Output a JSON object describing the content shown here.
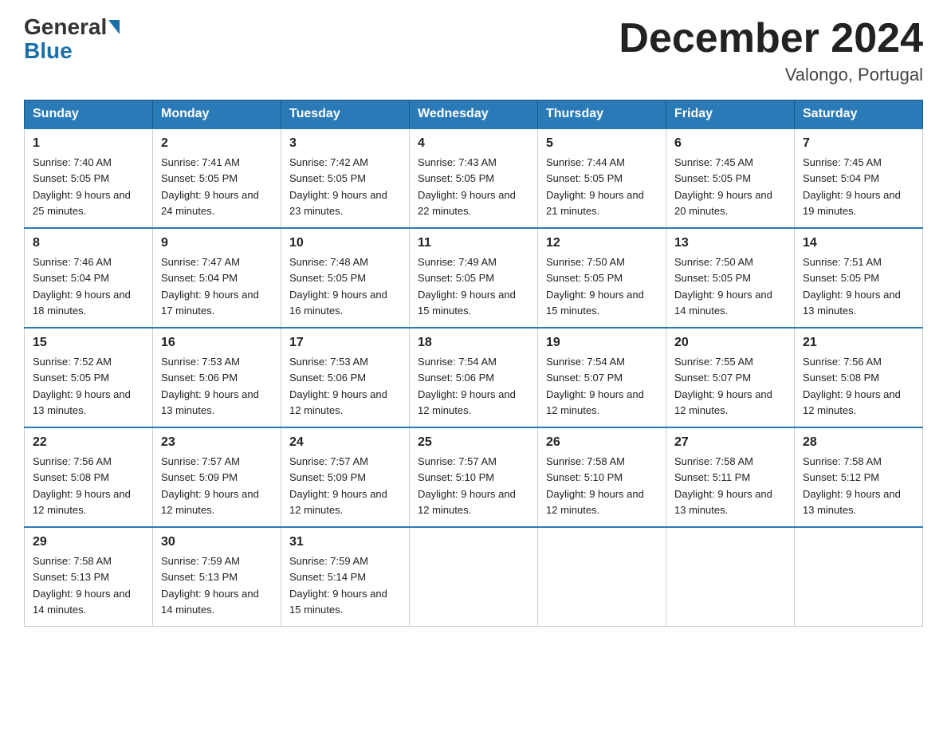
{
  "header": {
    "logo_general": "General",
    "logo_blue": "Blue",
    "month_title": "December 2024",
    "location": "Valongo, Portugal"
  },
  "days_of_week": [
    "Sunday",
    "Monday",
    "Tuesday",
    "Wednesday",
    "Thursday",
    "Friday",
    "Saturday"
  ],
  "weeks": [
    [
      {
        "day": "1",
        "sunrise": "7:40 AM",
        "sunset": "5:05 PM",
        "daylight": "9 hours and 25 minutes."
      },
      {
        "day": "2",
        "sunrise": "7:41 AM",
        "sunset": "5:05 PM",
        "daylight": "9 hours and 24 minutes."
      },
      {
        "day": "3",
        "sunrise": "7:42 AM",
        "sunset": "5:05 PM",
        "daylight": "9 hours and 23 minutes."
      },
      {
        "day": "4",
        "sunrise": "7:43 AM",
        "sunset": "5:05 PM",
        "daylight": "9 hours and 22 minutes."
      },
      {
        "day": "5",
        "sunrise": "7:44 AM",
        "sunset": "5:05 PM",
        "daylight": "9 hours and 21 minutes."
      },
      {
        "day": "6",
        "sunrise": "7:45 AM",
        "sunset": "5:05 PM",
        "daylight": "9 hours and 20 minutes."
      },
      {
        "day": "7",
        "sunrise": "7:45 AM",
        "sunset": "5:04 PM",
        "daylight": "9 hours and 19 minutes."
      }
    ],
    [
      {
        "day": "8",
        "sunrise": "7:46 AM",
        "sunset": "5:04 PM",
        "daylight": "9 hours and 18 minutes."
      },
      {
        "day": "9",
        "sunrise": "7:47 AM",
        "sunset": "5:04 PM",
        "daylight": "9 hours and 17 minutes."
      },
      {
        "day": "10",
        "sunrise": "7:48 AM",
        "sunset": "5:05 PM",
        "daylight": "9 hours and 16 minutes."
      },
      {
        "day": "11",
        "sunrise": "7:49 AM",
        "sunset": "5:05 PM",
        "daylight": "9 hours and 15 minutes."
      },
      {
        "day": "12",
        "sunrise": "7:50 AM",
        "sunset": "5:05 PM",
        "daylight": "9 hours and 15 minutes."
      },
      {
        "day": "13",
        "sunrise": "7:50 AM",
        "sunset": "5:05 PM",
        "daylight": "9 hours and 14 minutes."
      },
      {
        "day": "14",
        "sunrise": "7:51 AM",
        "sunset": "5:05 PM",
        "daylight": "9 hours and 13 minutes."
      }
    ],
    [
      {
        "day": "15",
        "sunrise": "7:52 AM",
        "sunset": "5:05 PM",
        "daylight": "9 hours and 13 minutes."
      },
      {
        "day": "16",
        "sunrise": "7:53 AM",
        "sunset": "5:06 PM",
        "daylight": "9 hours and 13 minutes."
      },
      {
        "day": "17",
        "sunrise": "7:53 AM",
        "sunset": "5:06 PM",
        "daylight": "9 hours and 12 minutes."
      },
      {
        "day": "18",
        "sunrise": "7:54 AM",
        "sunset": "5:06 PM",
        "daylight": "9 hours and 12 minutes."
      },
      {
        "day": "19",
        "sunrise": "7:54 AM",
        "sunset": "5:07 PM",
        "daylight": "9 hours and 12 minutes."
      },
      {
        "day": "20",
        "sunrise": "7:55 AM",
        "sunset": "5:07 PM",
        "daylight": "9 hours and 12 minutes."
      },
      {
        "day": "21",
        "sunrise": "7:56 AM",
        "sunset": "5:08 PM",
        "daylight": "9 hours and 12 minutes."
      }
    ],
    [
      {
        "day": "22",
        "sunrise": "7:56 AM",
        "sunset": "5:08 PM",
        "daylight": "9 hours and 12 minutes."
      },
      {
        "day": "23",
        "sunrise": "7:57 AM",
        "sunset": "5:09 PM",
        "daylight": "9 hours and 12 minutes."
      },
      {
        "day": "24",
        "sunrise": "7:57 AM",
        "sunset": "5:09 PM",
        "daylight": "9 hours and 12 minutes."
      },
      {
        "day": "25",
        "sunrise": "7:57 AM",
        "sunset": "5:10 PM",
        "daylight": "9 hours and 12 minutes."
      },
      {
        "day": "26",
        "sunrise": "7:58 AM",
        "sunset": "5:10 PM",
        "daylight": "9 hours and 12 minutes."
      },
      {
        "day": "27",
        "sunrise": "7:58 AM",
        "sunset": "5:11 PM",
        "daylight": "9 hours and 13 minutes."
      },
      {
        "day": "28",
        "sunrise": "7:58 AM",
        "sunset": "5:12 PM",
        "daylight": "9 hours and 13 minutes."
      }
    ],
    [
      {
        "day": "29",
        "sunrise": "7:58 AM",
        "sunset": "5:13 PM",
        "daylight": "9 hours and 14 minutes."
      },
      {
        "day": "30",
        "sunrise": "7:59 AM",
        "sunset": "5:13 PM",
        "daylight": "9 hours and 14 minutes."
      },
      {
        "day": "31",
        "sunrise": "7:59 AM",
        "sunset": "5:14 PM",
        "daylight": "9 hours and 15 minutes."
      },
      null,
      null,
      null,
      null
    ]
  ],
  "labels": {
    "sunrise_prefix": "Sunrise: ",
    "sunset_prefix": "Sunset: ",
    "daylight_prefix": "Daylight: "
  }
}
